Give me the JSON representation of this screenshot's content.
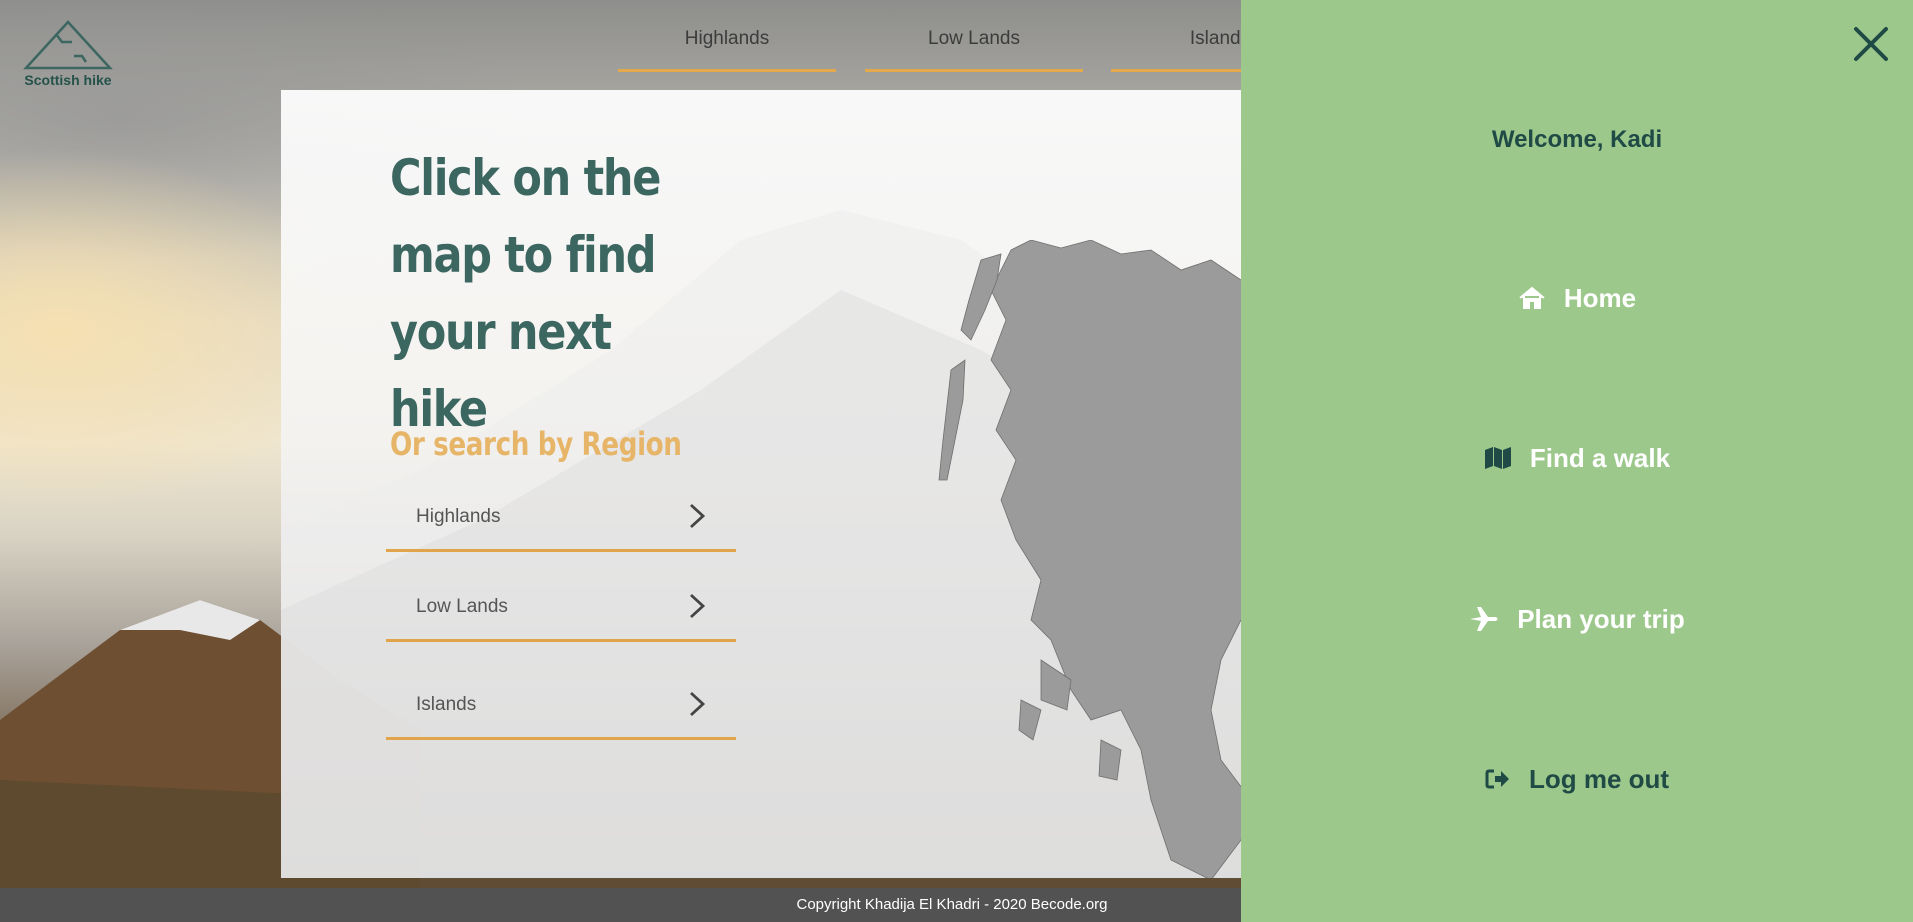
{
  "brand": {
    "name": "Scottish hike"
  },
  "top_nav": {
    "tabs": [
      "Highlands",
      "Low Lands",
      "Islands"
    ]
  },
  "main": {
    "headline_lines": [
      "Click on the",
      "map to find",
      "your next hike"
    ],
    "subheading": "Or search by Region",
    "regions": [
      "Highlands",
      "Low Lands",
      "Islands"
    ]
  },
  "side_panel": {
    "welcome": "Welcome, Kadi",
    "menu": [
      {
        "label": "Home",
        "icon": "home-icon"
      },
      {
        "label": "Find a walk",
        "icon": "map-icon"
      },
      {
        "label": "Plan your trip",
        "icon": "plane-icon"
      },
      {
        "label": "Log me out",
        "icon": "sign-out-icon"
      }
    ]
  },
  "footer": {
    "copyright": "Copyright Khadija El Khadri - 2020 Becode.org"
  },
  "colors": {
    "panel_bg": "#9dc88c",
    "accent_orange": "#e3a94a",
    "heading_teal": "#3c6660",
    "dark_green": "#1f4a45"
  }
}
